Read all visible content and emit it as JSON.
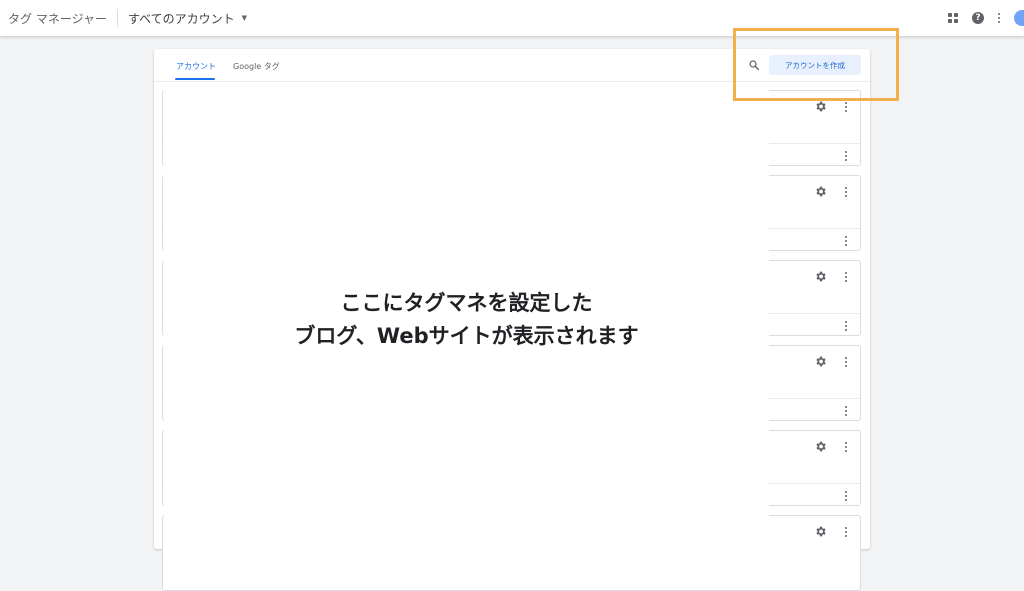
{
  "header": {
    "app_title": "タグ マネージャー",
    "account_selector": "すべてのアカウント"
  },
  "tabs": [
    {
      "label": "アカウント",
      "active": true
    },
    {
      "label": "Google タグ",
      "active": false
    }
  ],
  "toolbar": {
    "create_account_label": "アカウントを作成"
  },
  "overlay": {
    "line1": "ここにタグマネを設定した",
    "line2": "ブログ、Webサイトが表示されます"
  },
  "icons": {
    "apps": "apps-grid-icon",
    "help": "help-icon",
    "more": "more-vert-icon",
    "search": "search-icon",
    "settings": "gear-icon"
  },
  "colors": {
    "accent": "#1a73e8",
    "highlight": "#f2b04b",
    "button_bg": "#e8f0fe"
  }
}
